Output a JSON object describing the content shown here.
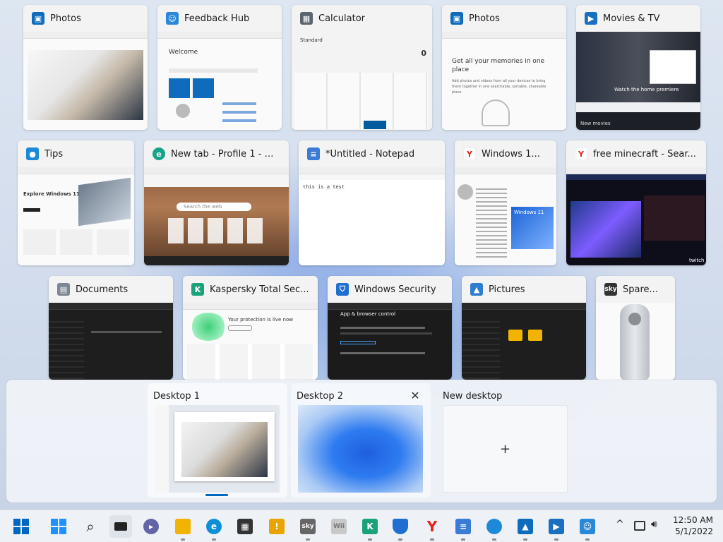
{
  "windows": [
    {
      "title": "Photos",
      "icon": "photos-icon",
      "color": "#0f6cbd"
    },
    {
      "title": "Feedback Hub",
      "icon": "feedback-hub-icon",
      "color": "#2b88d8"
    },
    {
      "title": "Calculator",
      "icon": "calculator-icon",
      "color": "#5a6570"
    },
    {
      "title": "Photos",
      "icon": "photos-icon",
      "color": "#0f6cbd"
    },
    {
      "title": "Movies & TV",
      "icon": "movies-tv-icon",
      "color": "#1a6fc0"
    },
    {
      "title": "Tips",
      "icon": "tips-icon",
      "color": "#1d89d9"
    },
    {
      "title": "New tab - Profile 1 - M...",
      "icon": "edge-icon",
      "color": "#17a38b"
    },
    {
      "title": "*Untitled - Notepad",
      "icon": "notepad-icon",
      "color": "#3a7bd5"
    },
    {
      "title": "Windows 1...",
      "icon": "yandex-icon",
      "color": "#e1251b"
    },
    {
      "title": "free minecraft - Sear...",
      "icon": "yandex-icon",
      "color": "#e1251b"
    },
    {
      "title": "Documents",
      "icon": "documents-icon",
      "color": "#7b8794"
    },
    {
      "title": "Kaspersky Total Sec...",
      "icon": "kaspersky-icon",
      "color": "#1aa37a"
    },
    {
      "title": "Windows Security",
      "icon": "windows-security-icon",
      "color": "#1f6fd1"
    },
    {
      "title": "Pictures",
      "icon": "pictures-icon",
      "color": "#2d7dd2"
    },
    {
      "title": "Spare...",
      "icon": "sky-icon",
      "color": "#333333"
    }
  ],
  "previews": {
    "calculator_display": "0",
    "calculator_mode": "Standard",
    "photos_heading": "Get all your memories in one place",
    "photos_sub": "Add photos and videos from all your devices to bring them together in one searchable, sortable, shareable place.",
    "movies_caption": "Watch the home premiere",
    "movies_section": "New movies",
    "tips_heading": "Explore Windows 11",
    "feedback_welcome": "Welcome",
    "edge_search": "Search the web",
    "notepad_text": "this is a test",
    "windows11_banner": "Windows 11",
    "win_security_heading": "App & browser control",
    "kaspersky_status": "Your protection is live now",
    "twitch_label": "twitch"
  },
  "desktops": [
    {
      "label": "Desktop 1"
    },
    {
      "label": "Desktop 2"
    },
    {
      "label": "New desktop"
    }
  ],
  "new_desktop_plus": "+",
  "close_glyph": "✕",
  "taskbar": {
    "apps": [
      {
        "name": "start-button",
        "color": "#0067c0"
      },
      {
        "name": "widgets-button",
        "color": "#1e90ff"
      },
      {
        "name": "search-button",
        "color": "#222222"
      },
      {
        "name": "task-view-button",
        "color": "#222222"
      },
      {
        "name": "teams-chat-button",
        "color": "#6264a7"
      },
      {
        "name": "file-explorer-button",
        "color": "#f2b400"
      },
      {
        "name": "edge-button",
        "color": "#0c8fd6"
      },
      {
        "name": "store-button",
        "color": "#333333"
      },
      {
        "name": "norton-button",
        "color": "#e8a400"
      },
      {
        "name": "sky-button",
        "color": "#666666"
      },
      {
        "name": "wii-button",
        "color": "#bbbbbb"
      },
      {
        "name": "kaspersky-button",
        "color": "#1aa37a"
      },
      {
        "name": "windows-security-button",
        "color": "#1f6fd1"
      },
      {
        "name": "yandex-button",
        "color": "#e1251b"
      },
      {
        "name": "notepad-button",
        "color": "#3a7bd5"
      },
      {
        "name": "tips-button",
        "color": "#1d89d9"
      },
      {
        "name": "photos-button",
        "color": "#0f6cbd"
      },
      {
        "name": "movies-tv-button",
        "color": "#1a6fc0"
      },
      {
        "name": "feedback-hub-button",
        "color": "#2b88d8"
      }
    ],
    "chevron": "^",
    "time": "12:50 AM",
    "date": "5/1/2022"
  }
}
